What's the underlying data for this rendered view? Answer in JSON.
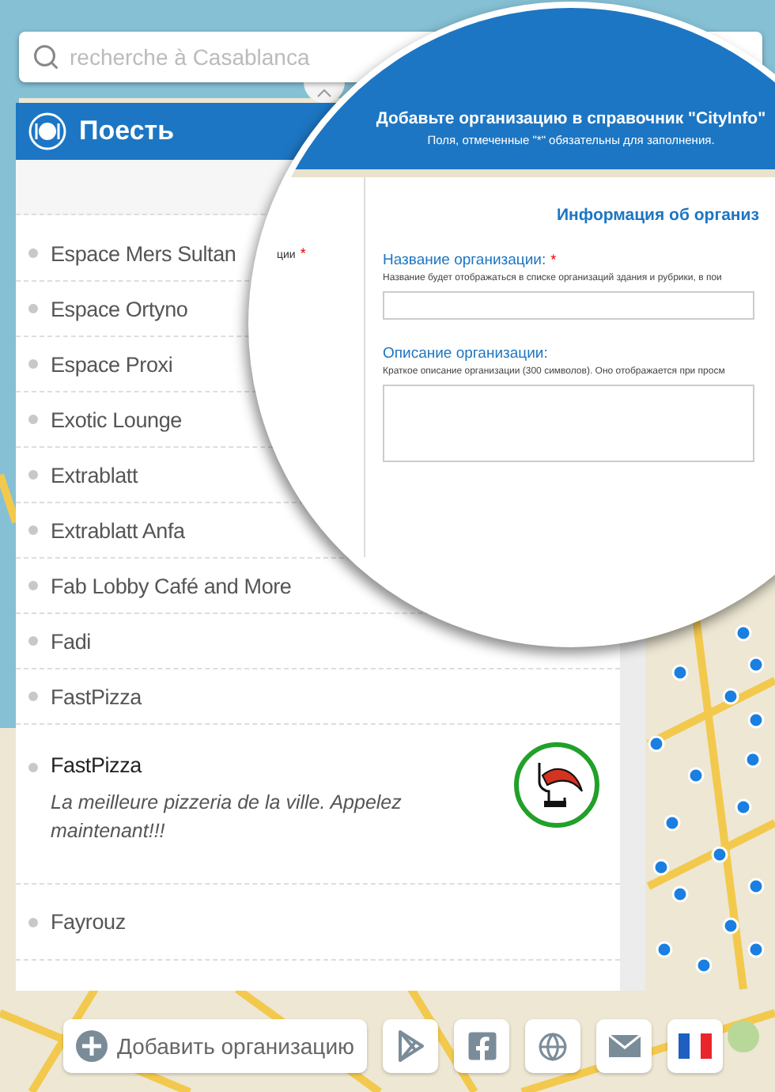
{
  "search": {
    "placeholder": "recherche à Casablanca"
  },
  "category": {
    "title": "Поесть"
  },
  "places": [
    {
      "kind": "plain",
      "name": "Espace Mers Sultan"
    },
    {
      "kind": "plain",
      "name": "Espace Ortyno"
    },
    {
      "kind": "plain",
      "name": "Espace Proxi"
    },
    {
      "kind": "plain",
      "name": "Exotic Lounge"
    },
    {
      "kind": "plain",
      "name": "Extrablatt"
    },
    {
      "kind": "plain",
      "name": "Extrablatt Anfa"
    },
    {
      "kind": "plain",
      "name": "Fab Lobby Café and More"
    },
    {
      "kind": "plain",
      "name": "Fadi"
    },
    {
      "kind": "plain",
      "name": "FastPizza"
    },
    {
      "kind": "featured",
      "name": "FastPizza",
      "description": "La meilleure pizzeria de la ville. Appelez maintenant!!!"
    },
    {
      "kind": "plain",
      "name": "Fayrouz"
    }
  ],
  "magnifier": {
    "required_mark": "*",
    "title": "Добавьте организацию в справочник \"CityInfo\"",
    "subtitle": "Поля, отмеченные \"*\" обязательны для заполнения.",
    "side_label": "ции",
    "side_label_required": true,
    "section_title": "Информация об организ",
    "fields": [
      {
        "kind": "input",
        "label": "Название организации:",
        "required": true,
        "hint": "Название будет отображаться в списке организаций здания и рубрики, в пои"
      },
      {
        "kind": "textarea",
        "label": "Описание организации:",
        "required": false,
        "hint": "Краткое описание организации (300 символов). Оно отображается при просм"
      }
    ]
  },
  "toolbar": {
    "add_button": "Добавить организацию",
    "icons": [
      {
        "kind": "store"
      },
      {
        "kind": "facebook"
      },
      {
        "kind": "web"
      },
      {
        "kind": "mail"
      },
      {
        "kind": "flag"
      }
    ]
  }
}
